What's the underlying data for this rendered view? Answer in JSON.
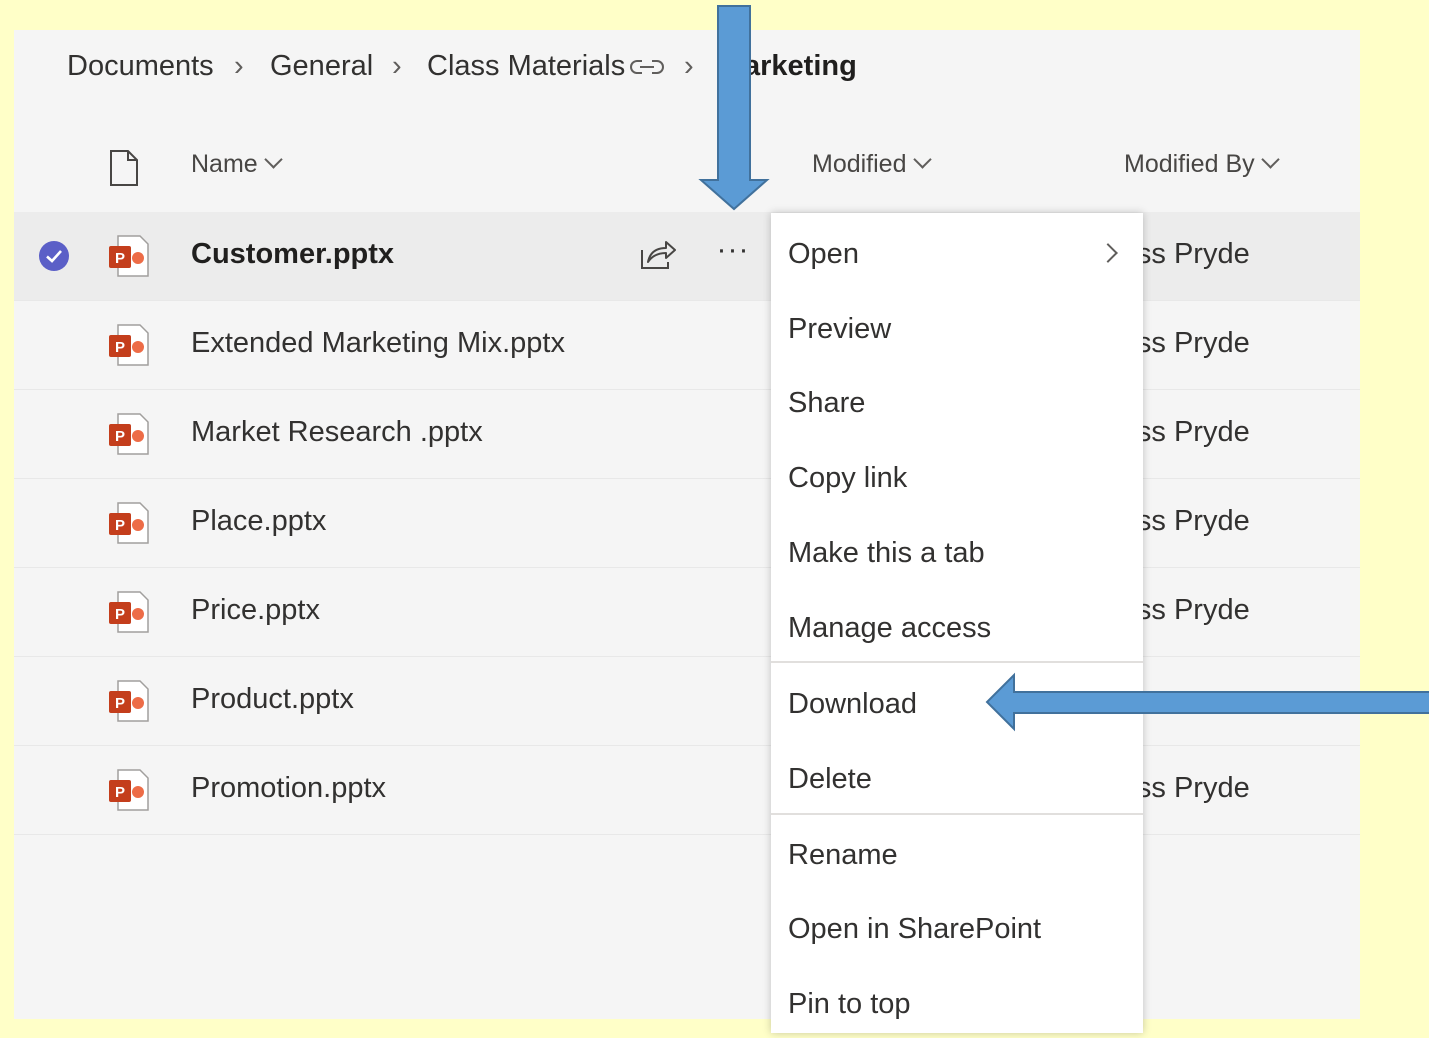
{
  "breadcrumb": {
    "items": [
      "Documents",
      "General",
      "Class Materials"
    ],
    "current": "arketing",
    "link_icon": "link-icon"
  },
  "header": {
    "name": "Name",
    "modified": "Modified",
    "modified_by": "Modified By",
    "file_type_icon": "file-type-icon"
  },
  "rows": [
    {
      "name": "Customer.pptx",
      "modified_by": "liss Pryde"
    },
    {
      "name": "Extended Marketing Mix.pptx",
      "modified_by": "liss Pryde"
    },
    {
      "name": "Market Research .pptx",
      "modified_by": "liss Pryde"
    },
    {
      "name": "Place.pptx",
      "modified_by": "liss Pryde"
    },
    {
      "name": "Price.pptx",
      "modified_by": "liss Pryde"
    },
    {
      "name": "Product.pptx",
      "modified_by": ""
    },
    {
      "name": "Promotion.pptx",
      "modified_by": "liss Pryde"
    }
  ],
  "selected_row": {
    "more_label": "···",
    "icons": [
      "check-circle-icon",
      "share-icon",
      "more-icon"
    ]
  },
  "menu": {
    "items": [
      "Open",
      "Preview",
      "Share",
      "Copy link",
      "Make this a tab",
      "Manage access",
      "Download",
      "Delete",
      "Rename",
      "Open in SharePoint",
      "Pin to top"
    ]
  },
  "colors": {
    "background": "#ffffc8",
    "panel": "#f5f5f5",
    "arrow": "#5b9bd5",
    "arrow_border": "#41719c",
    "check": "#5b5fc7",
    "ppt": "#c43e1c"
  }
}
